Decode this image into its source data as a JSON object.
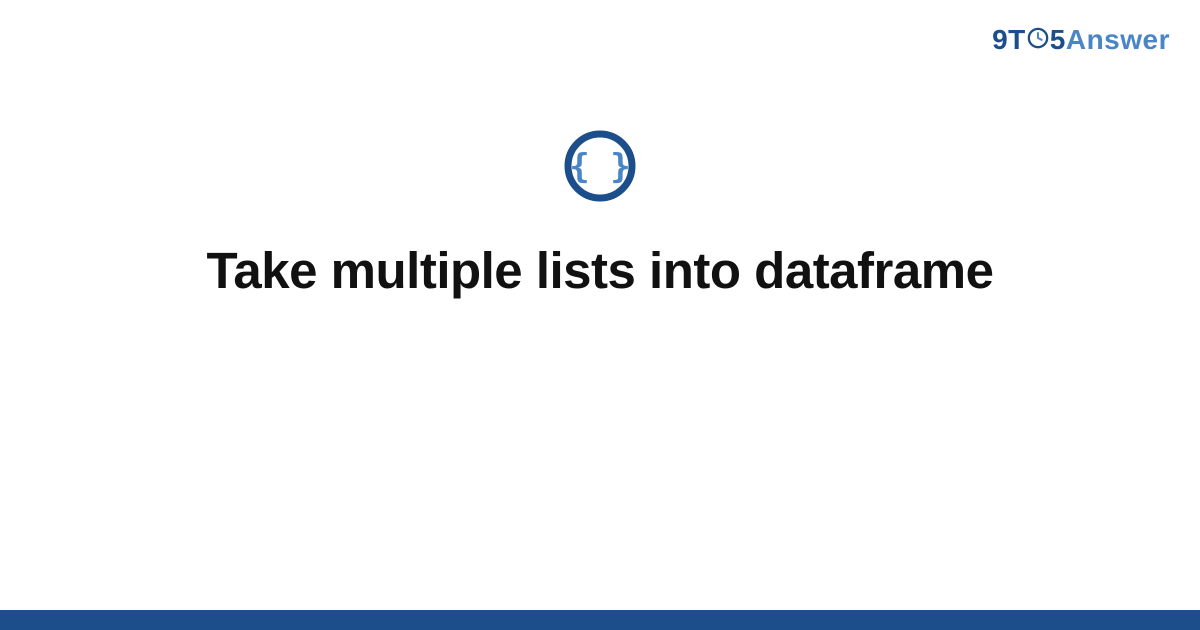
{
  "brand": {
    "part1": "9T",
    "part2": "5",
    "part3": "Answer"
  },
  "icon_name": "code-braces-icon",
  "title": "Take multiple lists into dataframe",
  "colors": {
    "brand_dark": "#1b4e8a",
    "brand_light": "#4a86c5"
  }
}
